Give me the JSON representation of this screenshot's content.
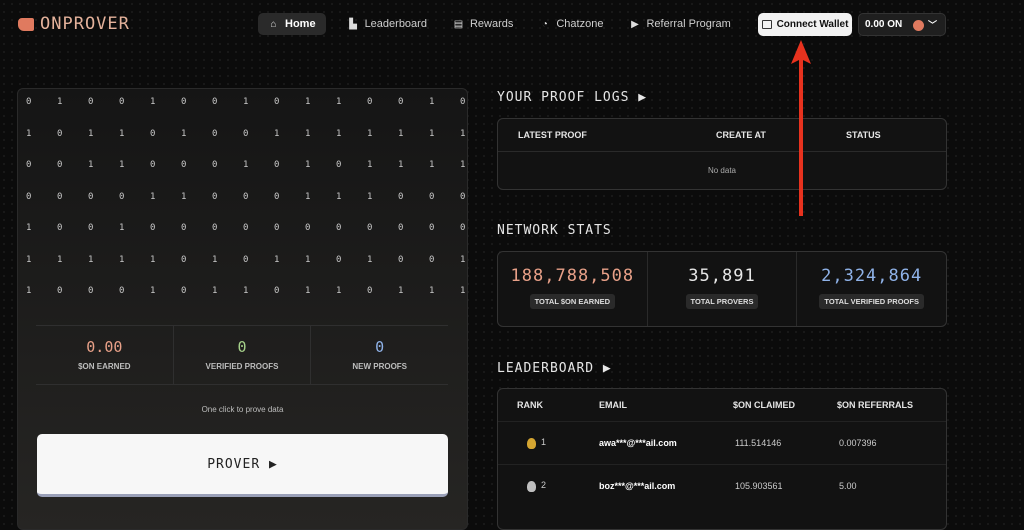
{
  "header": {
    "logo_text": "ONPROVER",
    "nav": [
      {
        "label": "Home",
        "icon": "home-icon",
        "active": true
      },
      {
        "label": "Leaderboard",
        "icon": "leaderboard-icon",
        "active": false
      },
      {
        "label": "Rewards",
        "icon": "rewards-icon",
        "active": false
      },
      {
        "label": "Chatzone",
        "icon": "chat-icon",
        "active": false
      },
      {
        "label": "Referral Program",
        "icon": "referral-icon",
        "active": false
      }
    ],
    "connect_wallet": "Connect Wallet",
    "balance": "0.00 ON"
  },
  "prover_panel": {
    "bits": [
      [
        "0",
        "1",
        "0",
        "0",
        "1",
        "0",
        "0",
        "1",
        "0",
        "1",
        "1",
        "0",
        "0",
        "1",
        "0"
      ],
      [
        "1",
        "0",
        "1",
        "1",
        "0",
        "1",
        "0",
        "0",
        "1",
        "1",
        "1",
        "1",
        "1",
        "1",
        "1"
      ],
      [
        "0",
        "0",
        "1",
        "1",
        "0",
        "0",
        "0",
        "1",
        "0",
        "1",
        "0",
        "1",
        "1",
        "1",
        "1"
      ],
      [
        "0",
        "0",
        "0",
        "0",
        "1",
        "1",
        "0",
        "0",
        "0",
        "1",
        "1",
        "1",
        "0",
        "0",
        "0"
      ],
      [
        "1",
        "0",
        "0",
        "1",
        "0",
        "0",
        "0",
        "0",
        "0",
        "0",
        "0",
        "0",
        "0",
        "0",
        "0"
      ],
      [
        "1",
        "1",
        "1",
        "1",
        "1",
        "0",
        "1",
        "0",
        "1",
        "1",
        "0",
        "1",
        "0",
        "0",
        "1"
      ],
      [
        "1",
        "0",
        "0",
        "0",
        "1",
        "0",
        "1",
        "1",
        "0",
        "1",
        "1",
        "0",
        "1",
        "1",
        "1"
      ]
    ],
    "stats": [
      {
        "value": "0.00",
        "label": "$ON EARNED",
        "color": "#e8a088"
      },
      {
        "value": "0",
        "label": "VERIFIED PROOFS",
        "color": "#a6d18a"
      },
      {
        "value": "0",
        "label": "NEW PROOFS",
        "color": "#8fb2e8"
      }
    ],
    "hint": "One click to prove data",
    "button": "PROVER ▶"
  },
  "proof_logs": {
    "title": "YOUR PROOF LOGS ▶",
    "columns": [
      "LATEST PROOF",
      "CREATE AT",
      "STATUS"
    ],
    "empty": "No data"
  },
  "network_stats": {
    "title": "NETWORK STATS",
    "items": [
      {
        "value": "188,788,508",
        "label": "TOTAL $ON EARNED",
        "color": "#e8a088"
      },
      {
        "value": "35,891",
        "label": "TOTAL PROVERS",
        "color": "#e6e6e6"
      },
      {
        "value": "2,324,864",
        "label": "TOTAL VERIFIED PROOFS",
        "color": "#8fb2e8"
      }
    ]
  },
  "leaderboard": {
    "title": "LEADERBOARD ▶",
    "columns": [
      "RANK",
      "EMAIL",
      "$ON CLAIMED",
      "$ON REFERRALS"
    ],
    "rows": [
      {
        "rank": "1",
        "email": "awa***@***ail.com",
        "claimed": "111.514146",
        "referrals": "0.007396",
        "medal": "#d4a531"
      },
      {
        "rank": "2",
        "email": "boz***@***ail.com",
        "claimed": "105.903561",
        "referrals": "5.00",
        "medal": "#bfbfbf"
      }
    ]
  }
}
